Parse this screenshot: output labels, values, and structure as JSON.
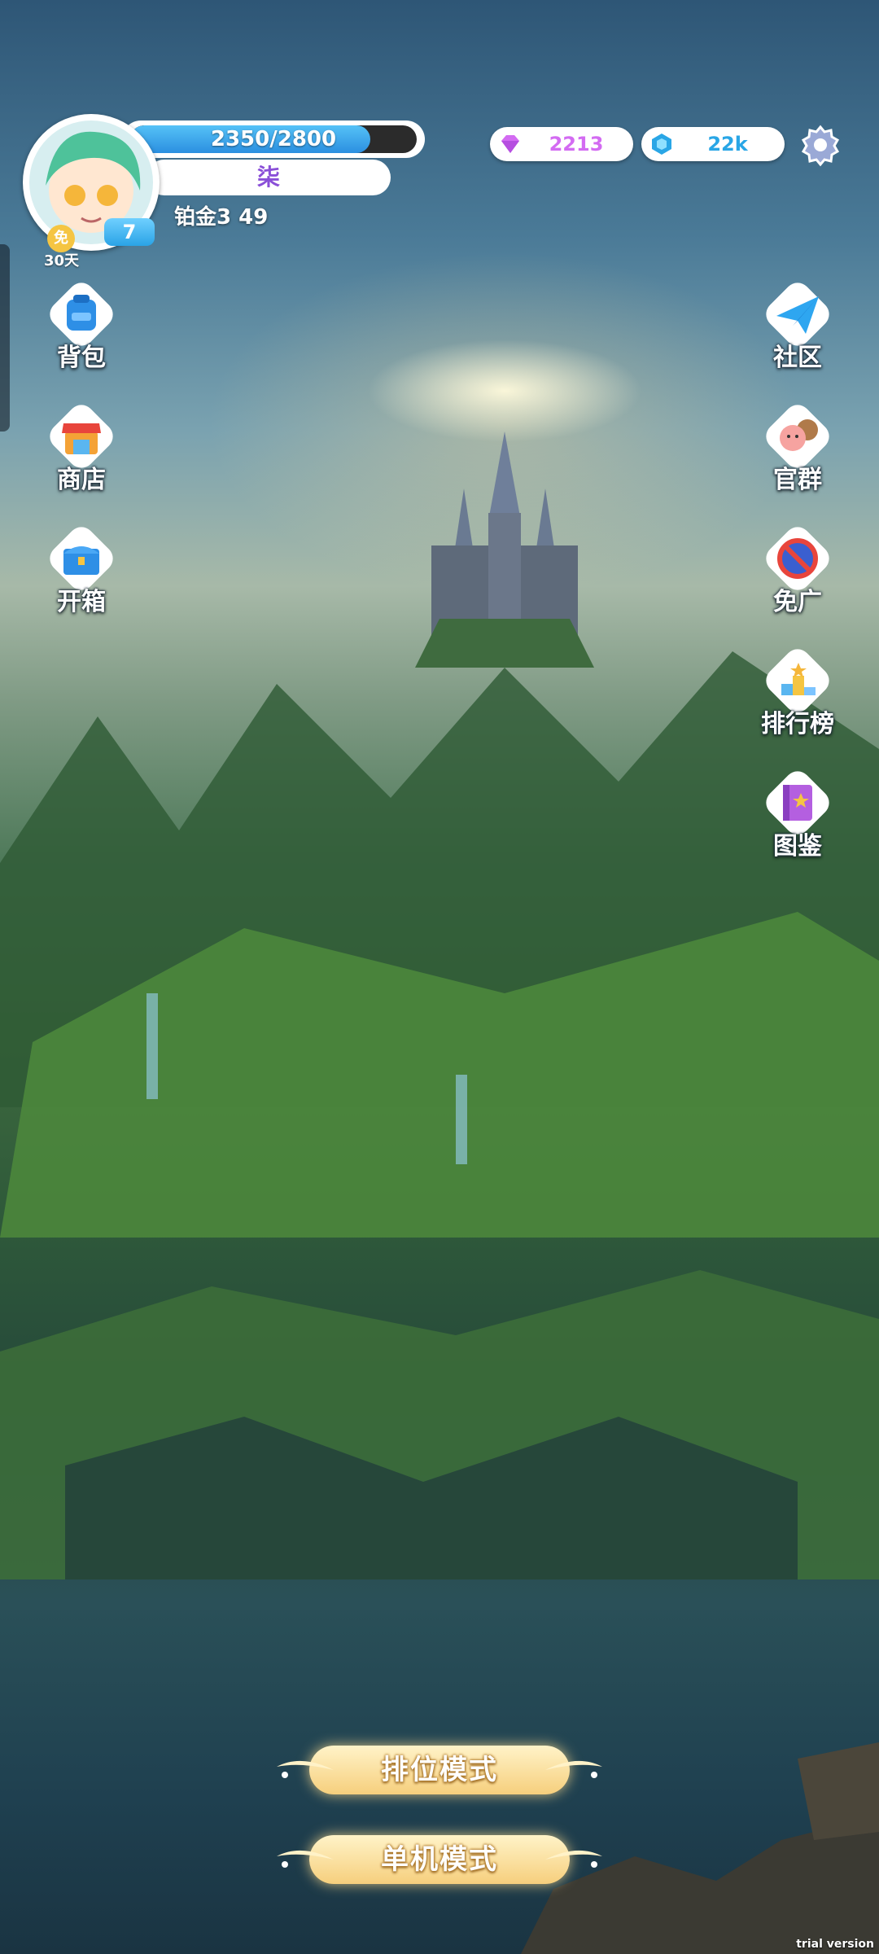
{
  "profile": {
    "hp_text": "2350/2800",
    "hp_progress": 0.839,
    "name": "柒",
    "rank": "铂金3 49",
    "level": "7",
    "free_badge": "免",
    "free_days": "30天"
  },
  "currencies": {
    "gems": "2213",
    "crystals": "22k"
  },
  "left_menu": [
    {
      "label": "背包",
      "icon": "backpack-icon"
    },
    {
      "label": "商店",
      "icon": "shop-icon"
    },
    {
      "label": "开箱",
      "icon": "chest-icon"
    }
  ],
  "right_menu": [
    {
      "label": "社区",
      "icon": "paper-plane-icon"
    },
    {
      "label": "官群",
      "icon": "group-icon"
    },
    {
      "label": "免广",
      "icon": "no-ads-icon"
    },
    {
      "label": "排行榜",
      "icon": "podium-icon"
    },
    {
      "label": "图鉴",
      "icon": "book-icon"
    }
  ],
  "modes": {
    "ranked": "排位模式",
    "single": "单机模式"
  },
  "watermark": "trial version",
  "colors": {
    "hp_fill": "#2b8fe0",
    "name": "#8a4fd8",
    "gem": "#d36bf2",
    "crystal": "#29a6e6",
    "mode_button": "#f6cf7d"
  }
}
